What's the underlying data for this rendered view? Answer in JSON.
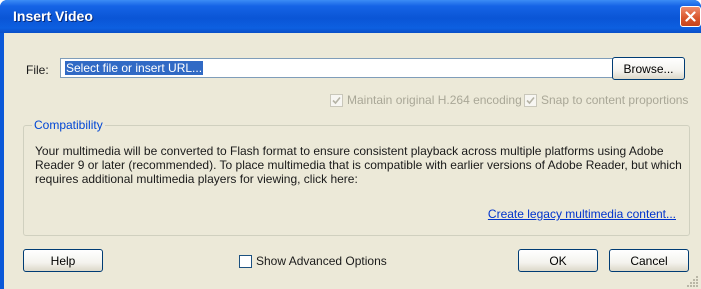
{
  "window": {
    "title": "Insert Video"
  },
  "file": {
    "label": "File:",
    "value": "Select file or insert URL...",
    "browse_label": "Browse..."
  },
  "options": {
    "maintain_encoding": {
      "label": "Maintain original H.264 encoding",
      "checked": true,
      "enabled": false
    },
    "snap_proportions": {
      "label": "Snap to content proportions",
      "checked": true,
      "enabled": false
    }
  },
  "compatibility": {
    "title": "Compatibility",
    "text": "Your multimedia will be converted to Flash format to ensure consistent playback across multiple platforms using Adobe Reader 9 or later (recommended). To place multimedia that is compatible with earlier versions of Adobe Reader, but which requires additional multimedia players for viewing, click here:",
    "link_label": "Create legacy multimedia content..."
  },
  "footer": {
    "help_label": "Help",
    "advanced_label": "Show Advanced Options",
    "advanced_checked": false,
    "ok_label": "OK",
    "cancel_label": "Cancel"
  },
  "colors": {
    "titlebar": "#0a55d6",
    "client_bg": "#ece9d8",
    "link": "#0033cc",
    "group_title": "#0046d5"
  },
  "icons": {
    "close": "close-icon",
    "check": "checkmark-icon",
    "grip": "resize-grip-icon"
  }
}
